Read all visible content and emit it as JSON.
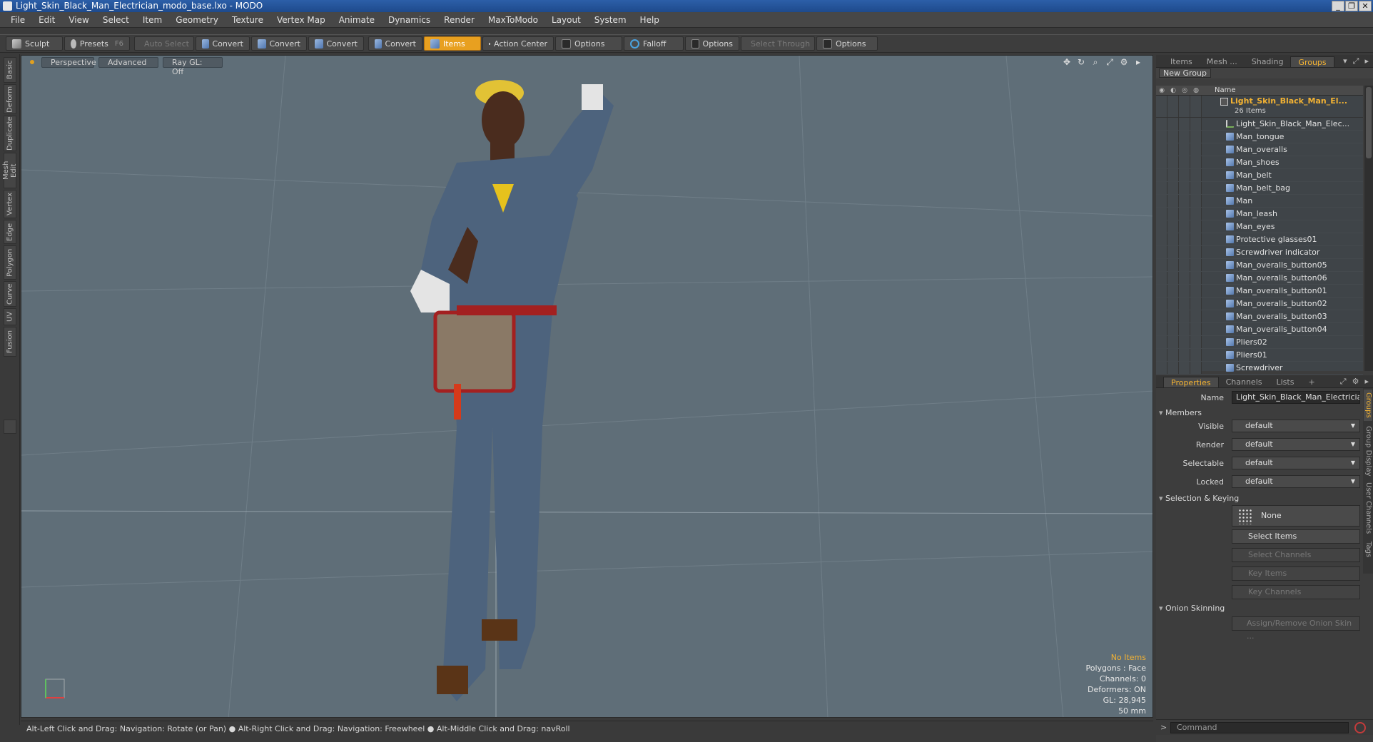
{
  "window": {
    "title": "Light_Skin_Black_Man_Electrician_modo_base.lxo - MODO"
  },
  "menu": [
    "File",
    "Edit",
    "View",
    "Select",
    "Item",
    "Geometry",
    "Texture",
    "Vertex Map",
    "Animate",
    "Dynamics",
    "Render",
    "MaxToModo",
    "Layout",
    "System",
    "Help"
  ],
  "toolbar": {
    "sculpt": "Sculpt",
    "presets": "Presets",
    "presets_key": "F6",
    "auto_select": "Auto Select",
    "convert1": "Convert",
    "convert2": "Convert",
    "convert3": "Convert",
    "convert4": "Convert",
    "items": "Items",
    "action_center": "Action Center",
    "options1": "Options",
    "falloff": "Falloff",
    "options2": "Options",
    "select_through": "Select Through",
    "options3": "Options"
  },
  "left_tabs": [
    "Basic",
    "Deform",
    "Duplicate",
    "Mesh Edit",
    "Vertex",
    "Edge",
    "Polygon",
    "Curve",
    "UV",
    "Fusion"
  ],
  "viewport": {
    "view": "Perspective",
    "shading": "Advanced",
    "raygl": "Ray GL: Off",
    "info": {
      "no_items": "No Items",
      "polygons": "Polygons : Face",
      "channels": "Channels: 0",
      "deformers": "Deformers: ON",
      "gl": "GL: 28,945",
      "scale": "50 mm"
    }
  },
  "status": "Alt-Left Click and Drag: Navigation: Rotate (or Pan) ● Alt-Right Click and Drag: Navigation: Freewheel ● Alt-Middle Click and Drag: navRoll",
  "top_panel": {
    "tabs": [
      "Items",
      "Mesh ...",
      "Shading",
      "Groups"
    ],
    "active_tab": "Groups",
    "new_group": "New Group",
    "col_name": "Name",
    "group": {
      "name": "Light_Skin_Black_Man_El...",
      "count": "26 Items"
    },
    "items": [
      "Light_Skin_Black_Man_Elec...",
      "Man_tongue",
      "Man_overalls",
      "Man_shoes",
      "Man_belt",
      "Man_belt_bag",
      "Man",
      "Man_leash",
      "Man_eyes",
      "Protective glasses01",
      "Screwdriver indicator",
      "Man_overalls_button05",
      "Man_overalls_button06",
      "Man_overalls_button01",
      "Man_overalls_button02",
      "Man_overalls_button03",
      "Man_overalls_button04",
      "Pliers02",
      "Pliers01",
      "Screwdriver"
    ]
  },
  "props_panel": {
    "tabs": [
      "Properties",
      "Channels",
      "Lists"
    ],
    "add_tab": "+",
    "name_label": "Name",
    "name_value": "Light_Skin_Black_Man_Electrician",
    "members": "Members",
    "visible_label": "Visible",
    "visible_value": "default",
    "render_label": "Render",
    "render_value": "default",
    "selectable_label": "Selectable",
    "selectable_value": "default",
    "locked_label": "Locked",
    "locked_value": "default",
    "selection_keying": "Selection & Keying",
    "none": "None",
    "select_items": "Select Items",
    "select_channels": "Select Channels",
    "key_items": "Key Items",
    "key_channels": "Key Channels",
    "onion": "Onion Skinning",
    "assign_onion": "Assign/Remove Onion Skin ...",
    "side_tabs": [
      "Groups",
      "Group Display",
      "User Channels",
      "Tags"
    ]
  },
  "command": {
    "prompt": ">",
    "placeholder": "Command"
  }
}
